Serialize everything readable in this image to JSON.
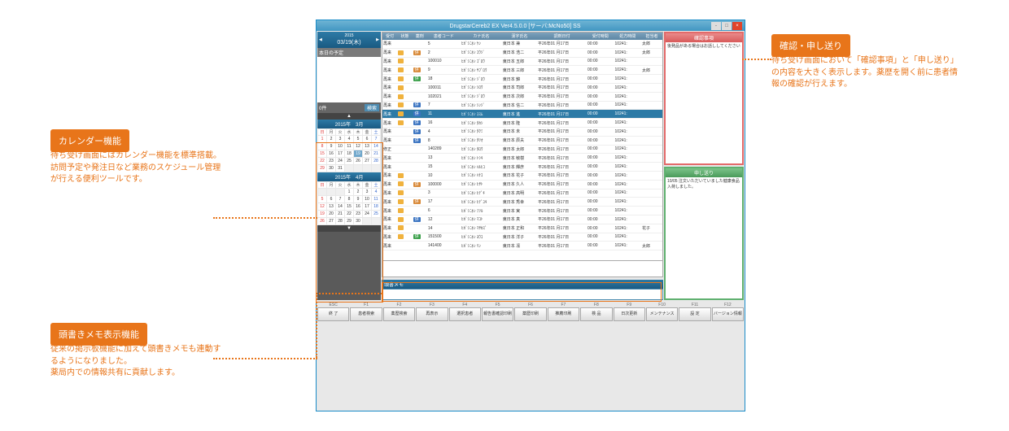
{
  "title": "DrugstarCereb2 EX Ver4.5.0.0 [サーバ:McNo50] SS",
  "date": {
    "y": "2015",
    "d": "03/19(木)"
  },
  "sched_label": "本日の予定",
  "count": "0件",
  "refresh": "検索",
  "cal1": {
    "title": "2015年　3月"
  },
  "cal2": {
    "title": "2015年　4月"
  },
  "dow": [
    "日",
    "月",
    "火",
    "水",
    "木",
    "金",
    "土"
  ],
  "cal1_cells": [
    [
      "1",
      "2",
      "3",
      "4",
      "5",
      "6",
      "7"
    ],
    [
      "8",
      "9",
      "10",
      "11",
      "12",
      "13",
      "14"
    ],
    [
      "15",
      "16",
      "17",
      "18",
      "19",
      "20",
      "21"
    ],
    [
      "22",
      "23",
      "24",
      "25",
      "26",
      "27",
      "28"
    ],
    [
      "29",
      "30",
      "31",
      "",
      "",
      "",
      ""
    ]
  ],
  "cal2_cells": [
    [
      "",
      "",
      "",
      "1",
      "2",
      "3",
      "4"
    ],
    [
      "5",
      "6",
      "7",
      "8",
      "9",
      "10",
      "11"
    ],
    [
      "12",
      "13",
      "14",
      "15",
      "16",
      "17",
      "18"
    ],
    [
      "19",
      "20",
      "21",
      "22",
      "23",
      "24",
      "25"
    ],
    [
      "26",
      "27",
      "28",
      "29",
      "30",
      "",
      ""
    ]
  ],
  "cols": [
    "受付",
    "状態",
    "薬剤",
    "患者コード",
    "カナ氏名",
    "漢字氏名",
    "調剤日付",
    "受付時間",
    "処方時間",
    "担当者"
  ],
  "rows": [
    {
      "a": "再来",
      "c": "",
      "code": "5",
      "kana": "ﾋｶﾞｼﾆﾎﾝ ｹﾝ",
      "kanji": "東日本 兼",
      "d": "平26年01 月17日",
      "t1": "00:00",
      "t2": "10241:",
      "p": "太郎"
    },
    {
      "a": "再来",
      "c": "f",
      "tag": "o",
      "code": "2",
      "kana": "ﾋｶﾞｼﾆﾎﾝ ｺｳｼﾞ",
      "kanji": "東日本 浩二",
      "d": "平26年01 月17日",
      "t1": "00:00",
      "t2": "10241:",
      "p": "太郎"
    },
    {
      "a": "再来",
      "c": "f",
      "code": "100010",
      "kana": "ﾋｶﾞｼﾆﾎﾝ ｺﾞﾛｳ",
      "kanji": "東日本 五郎",
      "d": "平26年01 月17日",
      "t1": "00:00",
      "t2": "10241:",
      "p": ""
    },
    {
      "a": "再来",
      "c": "f",
      "tag": "o",
      "code": "9",
      "kana": "ﾋｶﾞｼﾆﾎﾝ ｻﾌﾞﾛｳ",
      "kanji": "東日本 三郎",
      "d": "平26年01 月17日",
      "t1": "00:00",
      "t2": "10241:",
      "p": "太郎"
    },
    {
      "a": "再来",
      "c": "f",
      "tag": "g",
      "code": "18",
      "kana": "ﾋｶﾞｼﾆﾎﾝ ｼﾞﾛｳ",
      "kanji": "東日本 錦",
      "d": "平26年01 月17日",
      "t1": "00:00",
      "t2": "10241:",
      "p": ""
    },
    {
      "a": "再来",
      "c": "f",
      "code": "100011",
      "kana": "ﾋｶﾞｼﾆﾎﾝ ｼﾛｳ",
      "kanji": "東日本 司郎",
      "d": "平26年01 月17日",
      "t1": "00:00",
      "t2": "10241:",
      "p": ""
    },
    {
      "a": "再来",
      "c": "f",
      "code": "102021",
      "kana": "ﾋｶﾞｼﾆﾎﾝ ｼﾞﾛｳ",
      "kanji": "東日本 次郎",
      "d": "平26年01 月17日",
      "t1": "00:00",
      "t2": "10241:",
      "p": ""
    },
    {
      "a": "再来",
      "c": "f",
      "tag": "b",
      "code": "7",
      "kana": "ﾋｶﾞｼﾆﾎﾝ ｼﾝｼﾞ",
      "kanji": "東日本 信二",
      "d": "平26年01 月17日",
      "t1": "00:00",
      "t2": "10241:",
      "p": ""
    },
    {
      "a": "再来",
      "c": "f",
      "tag": "b",
      "code": "11",
      "kana": "ﾋｶﾞｼﾆﾎﾝ ｽｽﾑ",
      "kanji": "東日本 進",
      "d": "平26年01 月17日",
      "t1": "00:00",
      "t2": "10241:",
      "p": "",
      "sel": true
    },
    {
      "a": "再来",
      "c": "f",
      "tag": "b",
      "code": "16",
      "kana": "ﾋｶﾞｼﾆﾎﾝ ﾀｶｼ",
      "kanji": "東日本 隆",
      "d": "平26年01 月17日",
      "t1": "00:00",
      "t2": "10241:",
      "p": ""
    },
    {
      "a": "再来",
      "c": "",
      "tag": "b",
      "code": "4",
      "kana": "ﾋｶﾞｼﾆﾎﾝ ﾀｸﾐ",
      "kanji": "東日本 未",
      "d": "平26年01 月17日",
      "t1": "00:00",
      "t2": "10241:",
      "p": ""
    },
    {
      "a": "再来",
      "c": "",
      "tag": "b",
      "code": "8",
      "kana": "ﾋｶﾞｼﾆﾎﾝ ﾀﾂｵ",
      "kanji": "東日本 辰夫",
      "d": "平26年01 月17日",
      "t1": "00:00",
      "t2": "10241:",
      "p": ""
    },
    {
      "a": "修正",
      "c": "",
      "code": "140289",
      "kana": "ﾋｶﾞｼﾆﾎﾝ ﾀﾛｳ",
      "kanji": "東日本 太郎",
      "d": "平26年01 月17日",
      "t1": "00:00",
      "t2": "10241:",
      "p": ""
    },
    {
      "a": "再来",
      "c": "",
      "code": "13",
      "kana": "ﾋｶﾞｼﾆﾎﾝ ﾄｼｷ",
      "kanji": "東日本 敏樹",
      "d": "平26年01 月17日",
      "t1": "00:00",
      "t2": "10241:",
      "p": ""
    },
    {
      "a": "再来",
      "c": "",
      "code": "15",
      "kana": "ﾋｶﾞｼﾆﾎﾝ ﾊﾙﾋｺ",
      "kanji": "東日本 輝彦",
      "d": "平26年01 月17日",
      "t1": "00:00",
      "t2": "10241:",
      "p": ""
    },
    {
      "a": "再来",
      "c": "f",
      "code": "10",
      "kana": "ﾋｶﾞｼﾆﾎﾝ ﾊﾅｺ",
      "kanji": "東日本 花子",
      "d": "平26年01 月17日",
      "t1": "00:00",
      "t2": "10241:",
      "p": ""
    },
    {
      "a": "再来",
      "c": "f",
      "tag": "o",
      "code": "100000",
      "kana": "ﾋｶﾞｼﾆﾎﾝ ﾋｻﾄ",
      "kanji": "東日本 久人",
      "d": "平26年01 月17日",
      "t1": "00:00",
      "t2": "10241:",
      "p": ""
    },
    {
      "a": "再来",
      "c": "f",
      "code": "3",
      "kana": "ﾋｶﾞｼﾆﾎﾝ ﾋﾃﾞｷ",
      "kanji": "東日本 高明",
      "d": "平26年01 月17日",
      "t1": "00:00",
      "t2": "10241:",
      "p": ""
    },
    {
      "a": "再来",
      "c": "f",
      "tag": "o",
      "code": "17",
      "kana": "ﾋｶﾞｼﾆﾎﾝ ﾋﾃﾞﾕｷ",
      "kanji": "東日本 秀幸",
      "d": "平26年01 月17日",
      "t1": "00:00",
      "t2": "10241:",
      "p": ""
    },
    {
      "a": "再来",
      "c": "f",
      "code": "6",
      "kana": "ﾋｶﾞｼﾆﾎﾝ ﾐﾂﾙ",
      "kanji": "東日本 実",
      "d": "平26年01 月17日",
      "t1": "00:00",
      "t2": "10241:",
      "p": ""
    },
    {
      "a": "再来",
      "c": "f",
      "tag": "b",
      "code": "12",
      "kana": "ﾋｶﾞｼﾆﾎﾝ ﾏｺﾄ",
      "kanji": "東日本 真",
      "d": "平26年01 月17日",
      "t1": "00:00",
      "t2": "10241:",
      "p": ""
    },
    {
      "a": "再来",
      "c": "f",
      "code": "14",
      "kana": "ﾋｶﾞｼﾆﾎﾝ ﾏｻｶｽﾞ",
      "kanji": "東日本 正和",
      "d": "平26年01 月17日",
      "t1": "00:00",
      "t2": "10241:",
      "p": "花子"
    },
    {
      "a": "再来",
      "c": "f",
      "tag": "g",
      "code": "151500",
      "kana": "ﾋｶﾞｼﾆﾎﾝ ﾖｳｺ",
      "kanji": "東日本 洋子",
      "d": "平26年01 月17日",
      "t1": "00:00",
      "t2": "10241:",
      "p": ""
    },
    {
      "a": "再来",
      "c": "",
      "code": "141400",
      "kana": "ﾋｶﾞｼﾆﾎﾝ ﾘﾝ",
      "kanji": "東日本 凛",
      "d": "平26年01 月17日",
      "t1": "00:00",
      "t2": "10241:",
      "p": "太郎"
    }
  ],
  "memo_label": "頭書メモ",
  "confirm": {
    "title": "確認事項",
    "body": "後発品がある場合はお話ししてください"
  },
  "transfer": {
    "title": "申し送り",
    "body": "10/05 注文いただいていました健康食品入荷しました。"
  },
  "fkeys": [
    {
      "k": "ESC",
      "l": "終 了"
    },
    {
      "k": "F1",
      "l": "患者検索"
    },
    {
      "k": "F2",
      "l": "薬歴検索"
    },
    {
      "k": "F3",
      "l": "再表示"
    },
    {
      "k": "F4",
      "l": "選択患者"
    },
    {
      "k": "F5",
      "l": "報告書確認印刷"
    },
    {
      "k": "F6",
      "l": "薬歴印刷"
    },
    {
      "k": "F7",
      "l": "推薦印刷"
    },
    {
      "k": "F8",
      "l": "検 品"
    },
    {
      "k": "F9",
      "l": "日次更新"
    },
    {
      "k": "F10",
      "l": "メンテナンス"
    },
    {
      "k": "F11",
      "l": "設 定"
    },
    {
      "k": "F12",
      "l": "バージョン情報"
    }
  ],
  "call1": {
    "h": "カレンダー機能",
    "t": "待ち受け画面にはカレンダー機能を標準搭載。訪問予定や発注日など業務のスケジュール管理が行える便利ツールです。"
  },
  "call2": {
    "h": "頭書きメモ表示機能",
    "t": "従来の掲示板機能に加えて頭書きメモも連動するようになりました。\n薬局内での情報共有に貢献します。"
  },
  "call3": {
    "h": "確認・申し送り",
    "t": "待ち受け画面において「確認事項」と「申し送り」の内容を大きく表示します。薬歴を開く前に患者情報の確認が行えます。"
  }
}
